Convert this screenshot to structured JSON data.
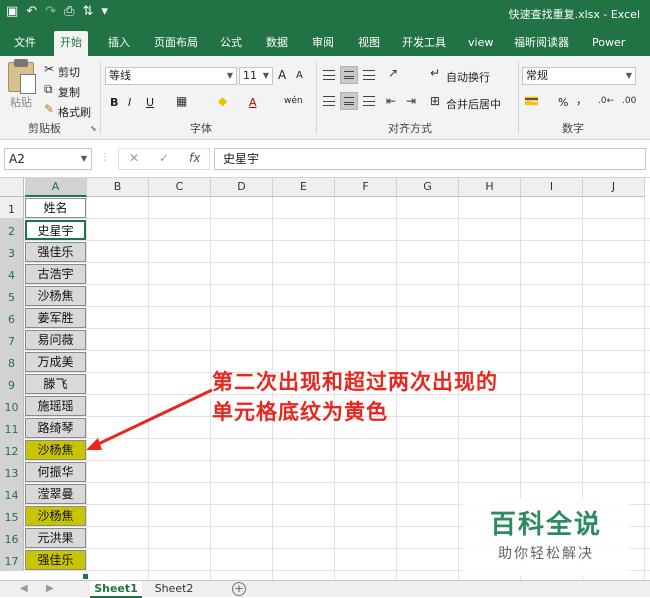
{
  "window": {
    "title": "快速查找重复.xlsx - Excel",
    "qat_icons": [
      "save-icon",
      "undo-icon",
      "redo-icon",
      "print-preview-icon",
      "sort-icon",
      "customize-icon"
    ]
  },
  "ribbon_tabs": [
    "文件",
    "开始",
    "插入",
    "页面布局",
    "公式",
    "数据",
    "审阅",
    "视图",
    "开发工具",
    "view",
    "福昕阅读器",
    "Power Pivot"
  ],
  "active_tab": "开始",
  "ribbon": {
    "clipboard": {
      "paste": "粘贴",
      "cut": "剪切",
      "copy": "复制",
      "format_painter": "格式刷",
      "label": "剪贴板"
    },
    "font": {
      "name": "等线",
      "size": "11",
      "bold": "B",
      "italic": "I",
      "underline": "U",
      "label": "字体",
      "grow": "A",
      "shrink": "A",
      "fill_icon": "fill-color-icon",
      "font_color": "A",
      "phonetic": "wén"
    },
    "alignment": {
      "wrap": "自动换行",
      "merge": "合并后居中",
      "label": "对齐方式"
    },
    "number": {
      "format": "常规",
      "percent": "%",
      "comma": "，",
      "label": "数字"
    }
  },
  "formula_bar": {
    "name_box": "A2",
    "cancel": "✕",
    "enter": "✓",
    "fx": "fx",
    "content": "史星宇"
  },
  "columns": [
    "A",
    "B",
    "C",
    "D",
    "E",
    "F",
    "G",
    "H",
    "I",
    "J"
  ],
  "rows": [
    "1",
    "2",
    "3",
    "4",
    "5",
    "6",
    "7",
    "8",
    "9",
    "10",
    "11",
    "12",
    "13",
    "14",
    "15",
    "16",
    "17"
  ],
  "cells": [
    {
      "text": "姓名",
      "fill": "white"
    },
    {
      "text": "史星宇",
      "fill": "active"
    },
    {
      "text": "强佳乐",
      "fill": "gray"
    },
    {
      "text": "古浩宇",
      "fill": "gray"
    },
    {
      "text": "沙杨焦",
      "fill": "gray"
    },
    {
      "text": "姜军胜",
      "fill": "gray"
    },
    {
      "text": "易问薇",
      "fill": "gray"
    },
    {
      "text": "万成美",
      "fill": "gray"
    },
    {
      "text": "滕飞",
      "fill": "gray"
    },
    {
      "text": "施瑶瑶",
      "fill": "gray"
    },
    {
      "text": "路绮琴",
      "fill": "gray"
    },
    {
      "text": "沙杨焦",
      "fill": "yellow"
    },
    {
      "text": "何振华",
      "fill": "gray"
    },
    {
      "text": "滢翠曼",
      "fill": "gray"
    },
    {
      "text": "沙杨焦",
      "fill": "yellow"
    },
    {
      "text": "元洪果",
      "fill": "gray"
    },
    {
      "text": "强佳乐",
      "fill": "yellow"
    }
  ],
  "annotation": {
    "line1": "第二次出现和超过两次出现的",
    "line2": "单元格底纹为黄色",
    "color": "#e8271e"
  },
  "sheet_tabs": [
    "Sheet1",
    "Sheet2"
  ],
  "active_sheet": "Sheet1",
  "watermark": {
    "title": "百科全说",
    "subtitle": "助你轻松解决"
  },
  "colors": {
    "excel_green": "#217346",
    "yellow_fill": "#c9c400",
    "gray_fill": "#d9d9d9"
  }
}
